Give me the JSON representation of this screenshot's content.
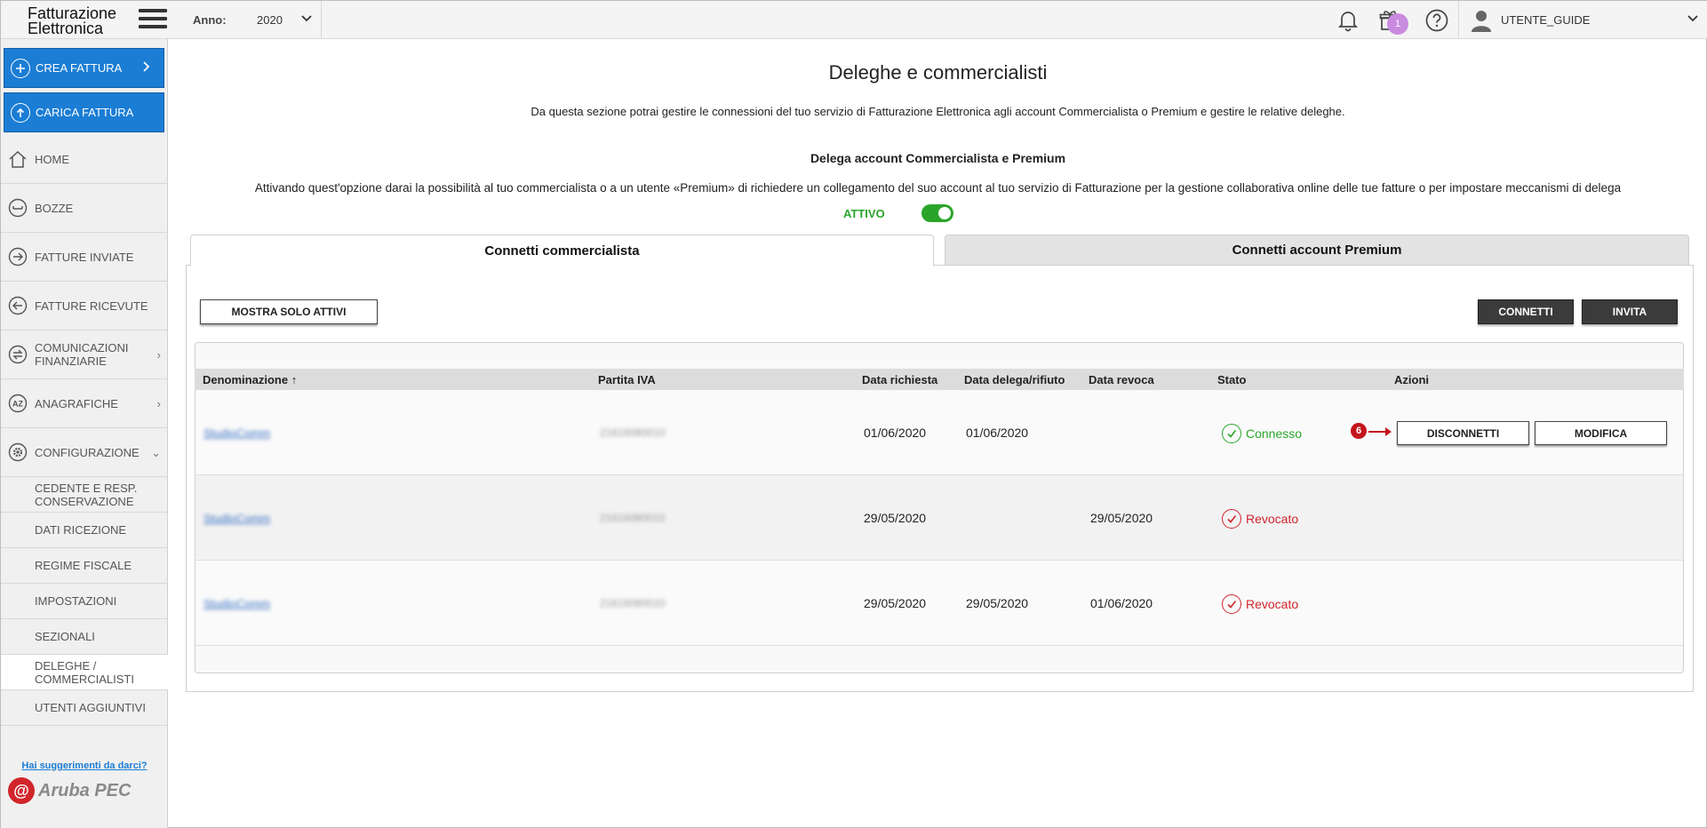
{
  "app": {
    "logo_line1": "Fatturazione",
    "logo_line2": "Elettronica",
    "year_label": "Anno:",
    "year_value": "2020",
    "user_name": "UTENTE_GUIDE",
    "gift_badge": "1",
    "accent_color": "#1b7dd4"
  },
  "sidebar": {
    "primary": [
      {
        "label": "CREA FATTURA",
        "icon": "plus-circle-icon"
      },
      {
        "label": "CARICA FATTURA",
        "icon": "upload-circle-icon"
      }
    ],
    "items": [
      {
        "label": "HOME",
        "icon": "home-icon"
      },
      {
        "label": "BOZZE",
        "icon": "drafts-icon"
      },
      {
        "label": "FATTURE INVIATE",
        "icon": "arrow-right-circle-icon"
      },
      {
        "label": "FATTURE RICEVUTE",
        "icon": "arrow-left-circle-icon"
      },
      {
        "label_line1": "COMUNICAZIONI",
        "label_line2": "FINANZIARIE",
        "icon": "exchange-icon"
      },
      {
        "label": "ANAGRAFICHE",
        "icon": "az-icon"
      },
      {
        "label": "CONFIGURAZIONE",
        "icon": "gear-icon"
      }
    ],
    "sub_items": [
      {
        "line1": "CEDENTE E RESP.",
        "line2": "CONSERVAZIONE"
      },
      {
        "line1": "DATI RICEZIONE",
        "line2": ""
      },
      {
        "line1": "REGIME FISCALE",
        "line2": ""
      },
      {
        "line1": "IMPOSTAZIONI",
        "line2": ""
      },
      {
        "line1": "SEZIONALI",
        "line2": ""
      },
      {
        "line1": "DELEGHE /",
        "line2": "COMMERCIALISTI"
      },
      {
        "line1": "UTENTI AGGIUNTIVI",
        "line2": ""
      }
    ],
    "suggest_link": "Hai suggerimenti da darci?",
    "brand_name": "Aruba PEC",
    "brand_seal": "@"
  },
  "main": {
    "title": "Deleghe e commercialisti",
    "description": "Da questa sezione potrai gestire le connessioni del tuo servizio di Fatturazione Elettronica agli account Commercialista o Premium e gestire le relative deleghe.",
    "delega_title": "Delega account Commercialista e Premium",
    "delega_description": "Attivando quest'opzione darai la possibilità al tuo commercialista o a un utente «Premium» di richiedere un collegamento del suo account al tuo servizio di Fatturazione per la gestione collaborativa online delle tue fatture o per impostare meccanismi di delega",
    "toggle_label": "ATTIVO",
    "tabs": [
      "Connetti commercialista",
      "Connetti account Premium"
    ],
    "buttons": {
      "show_active": "MOSTRA SOLO ATTIVI",
      "connect": "CONNETTI",
      "invite": "INVITA"
    },
    "table": {
      "headers": [
        "Denominazione",
        "Partita IVA",
        "Data richiesta",
        "Data delega/rifiuto",
        "Data revoca",
        "Stato",
        "Azioni"
      ],
      "sort_indicator": "↑",
      "rows": [
        {
          "name": "StudioComm",
          "piva": "21616080010",
          "data_richiesta": "01/06/2020",
          "data_delega": "01/06/2020",
          "data_revoca": "",
          "stato": "Connesso"
        },
        {
          "name": "StudioComm",
          "piva": "21616080010",
          "data_richiesta": "29/05/2020",
          "data_delega": "",
          "data_revoca": "29/05/2020",
          "stato": "Revocato"
        },
        {
          "name": "StudioComm",
          "piva": "21616080010",
          "data_richiesta": "29/05/2020",
          "data_delega": "29/05/2020",
          "data_revoca": "01/06/2020",
          "stato": "Revocato"
        }
      ],
      "row_actions": {
        "disconnect": "DISCONNETTI",
        "edit": "MODIFICA"
      }
    },
    "step_marker": "6"
  }
}
